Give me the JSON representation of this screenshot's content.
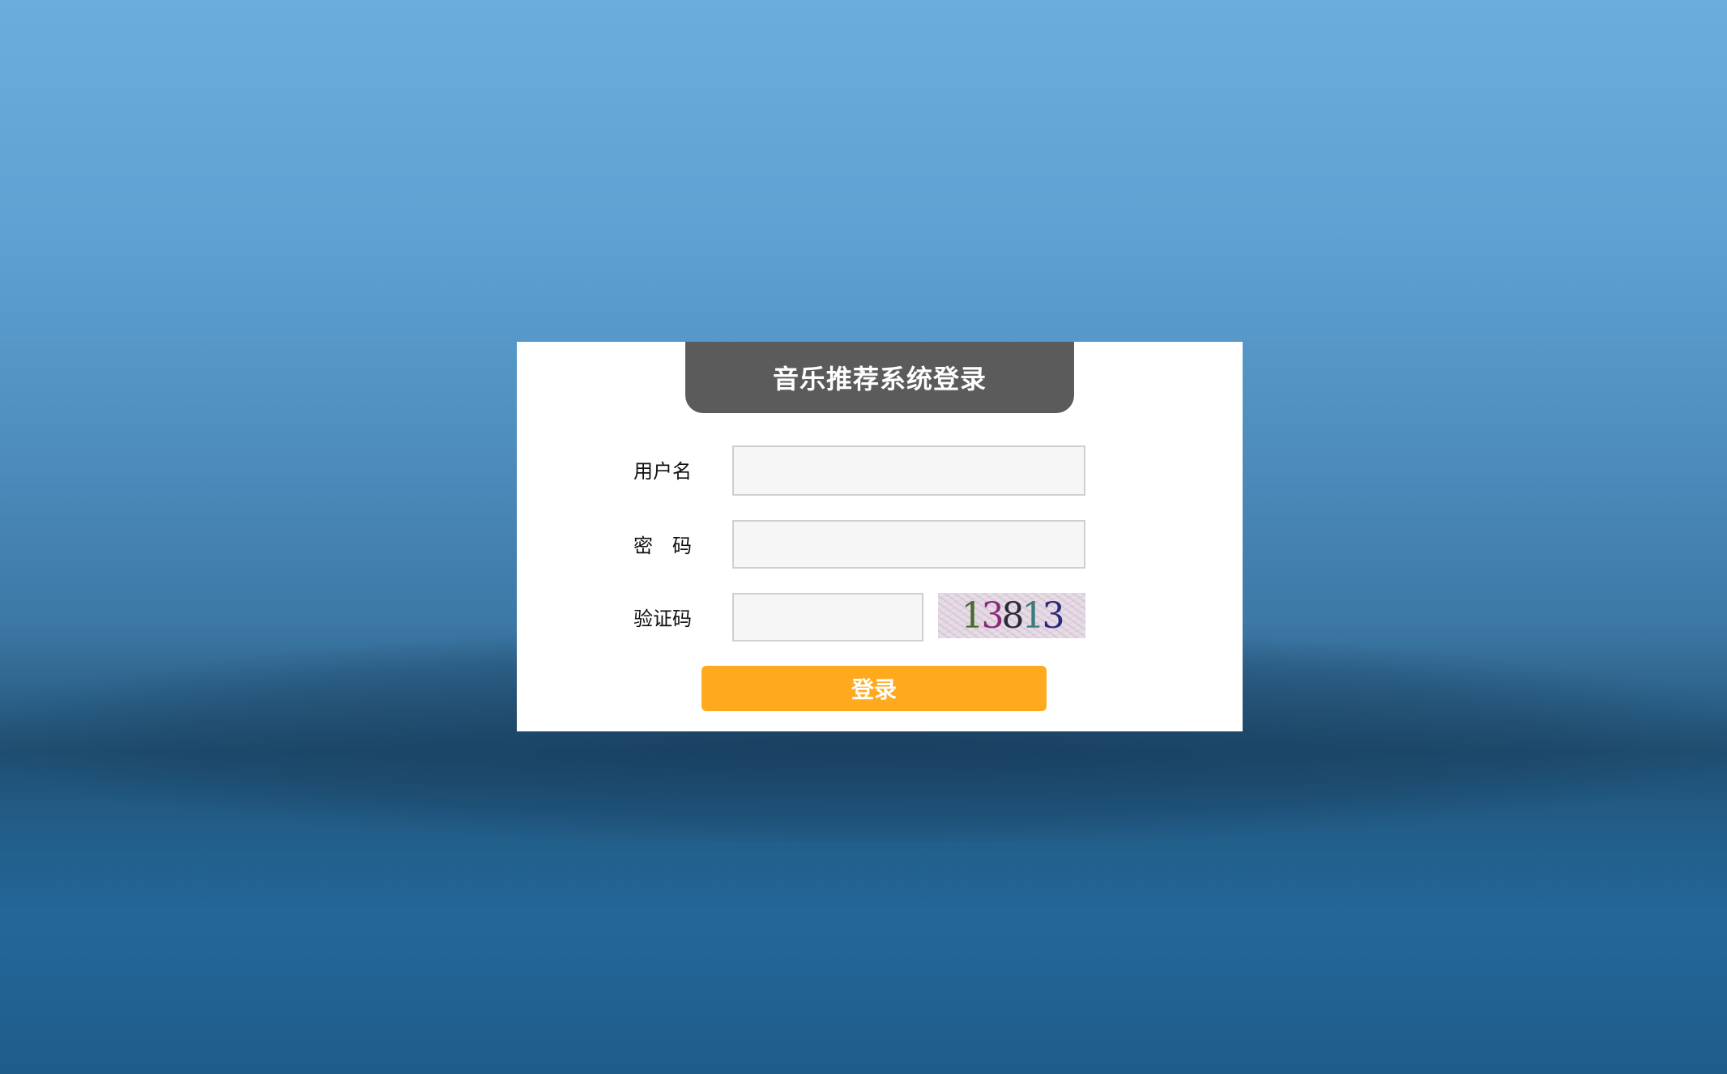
{
  "login": {
    "title": "音乐推荐系统登录",
    "username_label": "用户名",
    "username_value": "",
    "password_label": "密　码",
    "password_value": "",
    "captcha_label": "验证码",
    "captcha_value": "",
    "captcha_digits": [
      "1",
      "3",
      "8",
      "1",
      "3"
    ],
    "submit_label": "登录"
  },
  "colors": {
    "title_tab": "#5b5b5b",
    "panel": "#ffffff",
    "submit_button": "#ffa91e",
    "input_bg": "#f6f6f6",
    "captcha_digits": [
      "#4a6a32",
      "#8a2a7a",
      "#2a2a3a",
      "#3a7a7a",
      "#2a2a7a"
    ]
  }
}
